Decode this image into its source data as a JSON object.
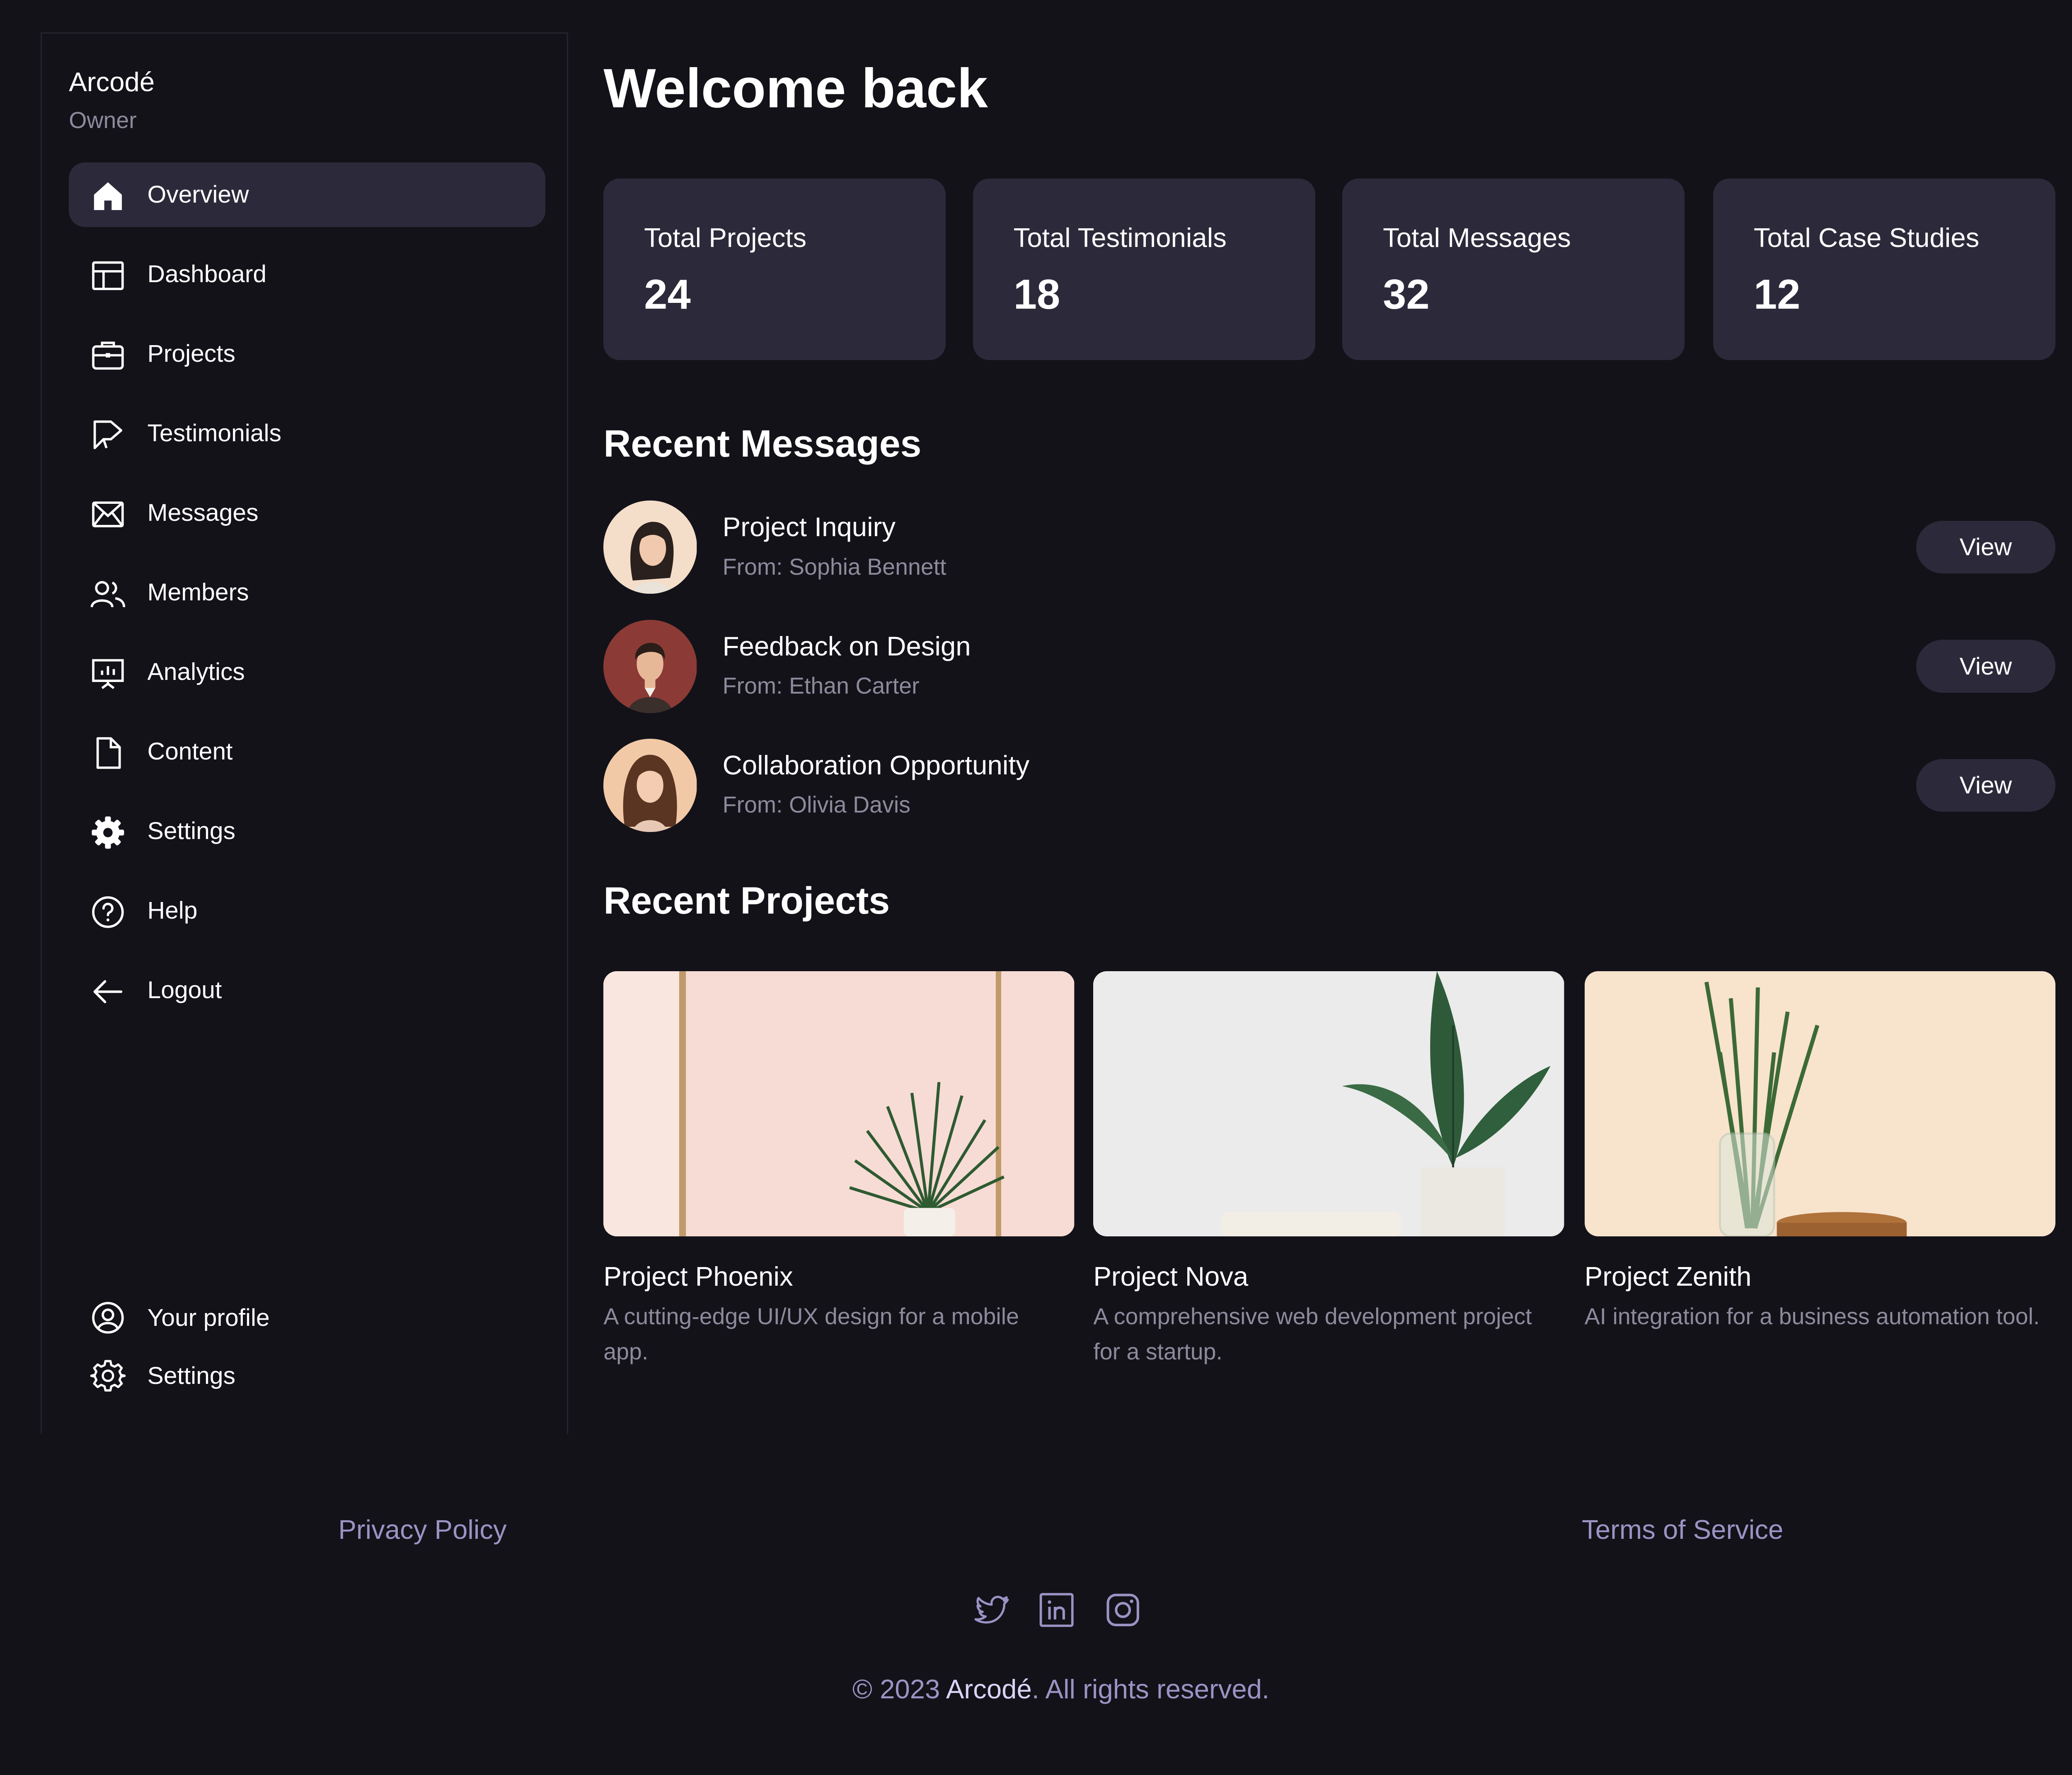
{
  "sidebar": {
    "brand": "Arcodé",
    "role": "Owner",
    "items": [
      {
        "label": "Overview",
        "icon": "home-icon"
      },
      {
        "label": "Dashboard",
        "icon": "layout-icon"
      },
      {
        "label": "Projects",
        "icon": "briefcase-icon"
      },
      {
        "label": "Testimonials",
        "icon": "megaphone-icon"
      },
      {
        "label": "Messages",
        "icon": "mail-icon"
      },
      {
        "label": "Members",
        "icon": "users-icon"
      },
      {
        "label": "Analytics",
        "icon": "presentation-chart-icon"
      },
      {
        "label": "Content",
        "icon": "document-icon"
      },
      {
        "label": "Settings",
        "icon": "cog-filled-icon"
      },
      {
        "label": "Help",
        "icon": "question-circle-icon"
      },
      {
        "label": "Logout",
        "icon": "arrow-left-icon"
      }
    ],
    "active_item": "Overview",
    "bottom": [
      {
        "label": "Your profile",
        "icon": "user-circle-icon"
      },
      {
        "label": "Settings",
        "icon": "cog-outline-icon"
      }
    ]
  },
  "main": {
    "title": "Welcome back",
    "stats": [
      {
        "label": "Total Projects",
        "value": "24"
      },
      {
        "label": "Total Testimonials",
        "value": "18"
      },
      {
        "label": "Total Messages",
        "value": "32"
      },
      {
        "label": "Total Case Studies",
        "value": "12"
      }
    ],
    "recent_messages": {
      "title": "Recent Messages",
      "items": [
        {
          "subject": "Project Inquiry",
          "from": "From: Sophia Bennett",
          "action": "View"
        },
        {
          "subject": "Feedback on Design",
          "from": "From: Ethan Carter",
          "action": "View"
        },
        {
          "subject": "Collaboration Opportunity",
          "from": "From: Olivia Davis",
          "action": "View"
        }
      ]
    },
    "recent_projects": {
      "title": "Recent Projects",
      "items": [
        {
          "title": "Project Phoenix",
          "description": "A cutting-edge UI/UX design for a mobile app."
        },
        {
          "title": "Project Nova",
          "description": "A comprehensive web development project for a startup."
        },
        {
          "title": "Project Zenith",
          "description": "AI integration for a business automation tool."
        }
      ]
    }
  },
  "footer": {
    "privacy": "Privacy Policy",
    "terms": "Terms of Service",
    "social": [
      "twitter-icon",
      "linkedin-icon",
      "instagram-icon"
    ],
    "copyright_prefix": "© 2023 ",
    "copyright_brand": "Arcodé",
    "copyright_suffix": ". All rights reserved."
  },
  "colors": {
    "background": "#131219",
    "card": "#2c2a3a",
    "muted_text": "#8e8a9c",
    "footer_text": "#9b93c4"
  }
}
